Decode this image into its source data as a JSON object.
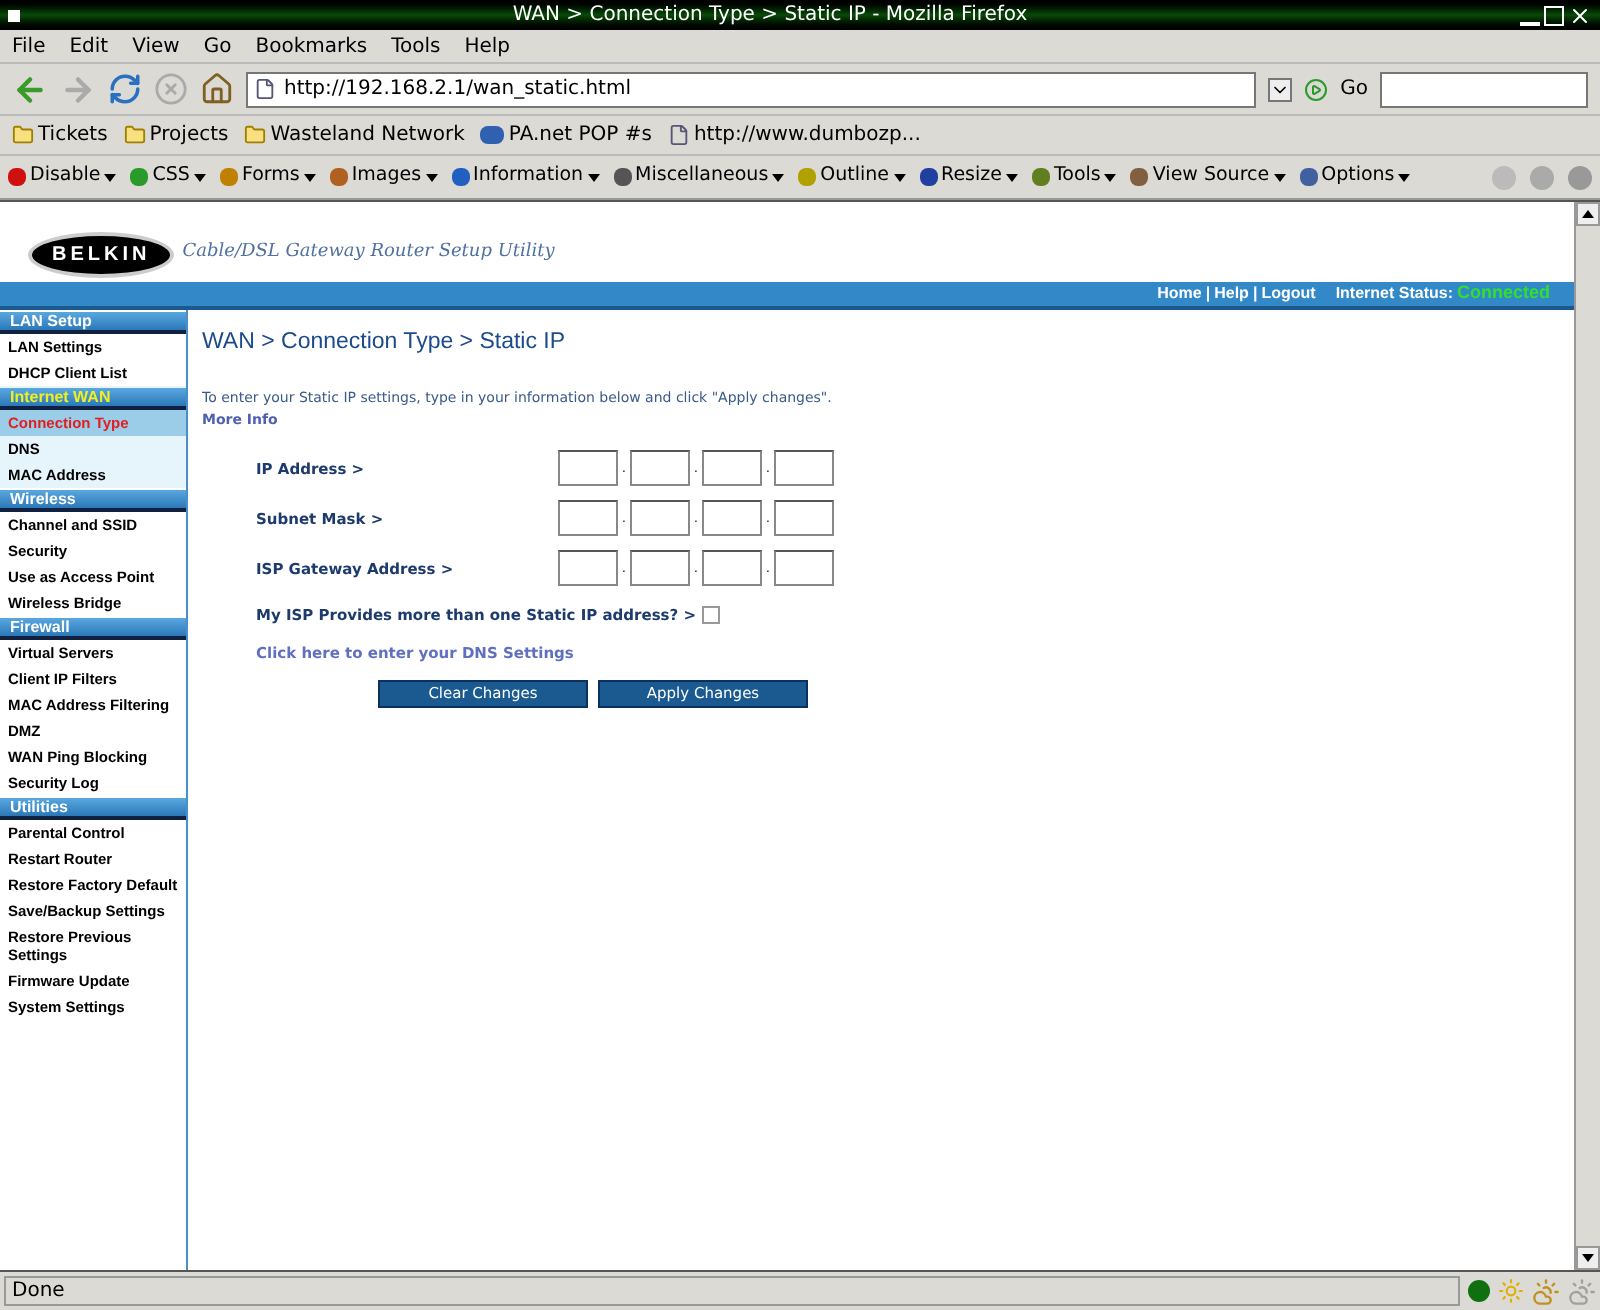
{
  "window": {
    "title": "WAN > Connection Type > Static IP - Mozilla Firefox"
  },
  "menu": [
    "File",
    "Edit",
    "View",
    "Go",
    "Bookmarks",
    "Tools",
    "Help"
  ],
  "navbar": {
    "url": "http://192.168.2.1/wan_static.html",
    "go": "Go"
  },
  "bookmarks": [
    {
      "label": "Tickets",
      "kind": "folder"
    },
    {
      "label": "Projects",
      "kind": "folder"
    },
    {
      "label": "Wasteland Network",
      "kind": "folder"
    },
    {
      "label": "PA.net POP #s",
      "kind": "feed"
    },
    {
      "label": "http://www.dumbozp...",
      "kind": "page"
    }
  ],
  "dev_toolbar": [
    "Disable",
    "CSS",
    "Forms",
    "Images",
    "Information",
    "Miscellaneous",
    "Outline",
    "Resize",
    "Tools",
    "View Source",
    "Options"
  ],
  "header": {
    "logo": "BELKIN",
    "tagline": "Cable/DSL Gateway Router Setup Utility",
    "links": [
      "Home",
      "Help",
      "Logout"
    ],
    "separator": "|",
    "status_label": "Internet Status:",
    "status_value": "Connected"
  },
  "sidebar": [
    {
      "title": "LAN Setup",
      "active": false,
      "items": [
        {
          "label": "LAN Settings",
          "selected": false
        },
        {
          "label": "DHCP Client List",
          "selected": false
        }
      ]
    },
    {
      "title": "Internet WAN",
      "active": true,
      "items": [
        {
          "label": "Connection Type",
          "selected": true
        },
        {
          "label": "DNS",
          "selected": false
        },
        {
          "label": "MAC Address",
          "selected": false
        }
      ]
    },
    {
      "title": "Wireless",
      "active": false,
      "items": [
        {
          "label": "Channel and SSID",
          "selected": false
        },
        {
          "label": "Security",
          "selected": false
        },
        {
          "label": "Use as Access Point",
          "selected": false
        },
        {
          "label": "Wireless Bridge",
          "selected": false
        }
      ]
    },
    {
      "title": "Firewall",
      "active": false,
      "items": [
        {
          "label": "Virtual Servers",
          "selected": false
        },
        {
          "label": "Client IP Filters",
          "selected": false
        },
        {
          "label": "MAC Address Filtering",
          "selected": false
        },
        {
          "label": "DMZ",
          "selected": false
        },
        {
          "label": "WAN Ping Blocking",
          "selected": false
        },
        {
          "label": "Security Log",
          "selected": false
        }
      ]
    },
    {
      "title": "Utilities",
      "active": false,
      "items": [
        {
          "label": "Parental Control",
          "selected": false
        },
        {
          "label": "Restart Router",
          "selected": false
        },
        {
          "label": "Restore Factory Default",
          "selected": false
        },
        {
          "label": "Save/Backup Settings",
          "selected": false
        },
        {
          "label": "Restore Previous Settings",
          "selected": false
        },
        {
          "label": "Firmware Update",
          "selected": false
        },
        {
          "label": "System Settings",
          "selected": false
        }
      ]
    }
  ],
  "page": {
    "heading": "WAN > Connection Type > Static IP",
    "intro": "To enter your Static IP settings, type in your information below and click \"Apply changes\".",
    "more_info": "More Info",
    "fields": [
      {
        "label": "IP Address >"
      },
      {
        "label": "Subnet Mask >"
      },
      {
        "label": "ISP Gateway Address >"
      }
    ],
    "ip_separator": ".",
    "multi_ip": {
      "label": "My ISP Provides more than one Static IP address? >",
      "checked": false
    },
    "dns_link": "Click here to enter your DNS Settings",
    "buttons": [
      "Clear Changes",
      "Apply Changes"
    ]
  },
  "status_bar": {
    "text": "Done"
  }
}
